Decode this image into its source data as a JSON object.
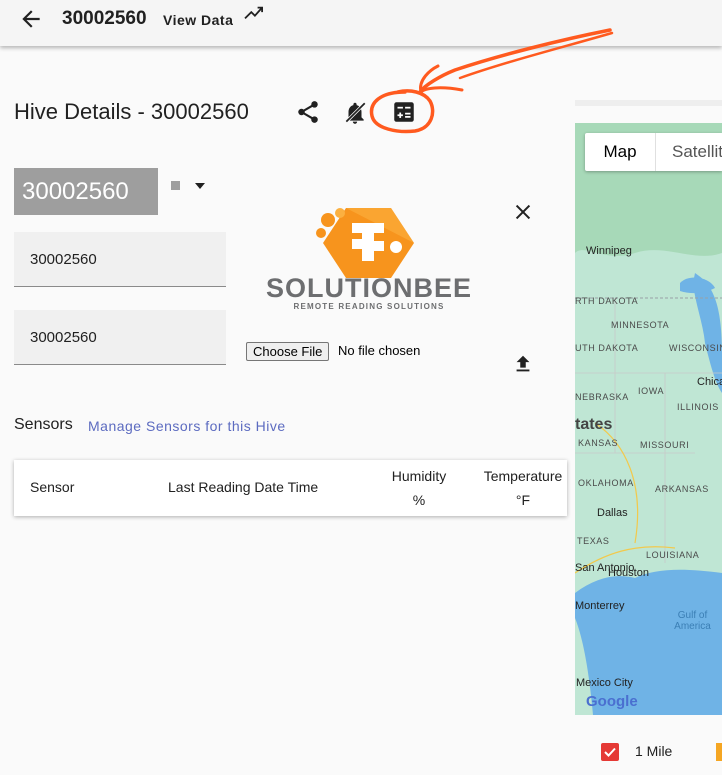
{
  "header": {
    "hive_id": "30002560",
    "subtitle": "View Data",
    "back_icon": "arrow-left-icon",
    "trend_icon": "trending-up-icon"
  },
  "details": {
    "title": "Hive Details - 30002560",
    "toolbar_icons": [
      "share-icon",
      "bell-off-icon",
      "calculator-icon"
    ],
    "annotation_color": "#ff5a1f"
  },
  "form": {
    "id_display": "30002560",
    "field1_value": "30002560",
    "field2_value": "30002560"
  },
  "logo": {
    "name": "SOLUTIONBEE",
    "tagline": "REMOTE READING SOLUTIONS"
  },
  "file": {
    "choose_label": "Choose File",
    "status": "No file chosen"
  },
  "sensors": {
    "label": "Sensors",
    "manage_link": "Manage Sensors for this Hive",
    "columns": [
      {
        "line1": "Sensor",
        "line2": ""
      },
      {
        "line1": "Last Reading Date Time",
        "line2": ""
      },
      {
        "line1": "Humidity",
        "line2": "%"
      },
      {
        "line1": "Temperature",
        "line2": "°F"
      }
    ]
  },
  "map": {
    "type_map": "Map",
    "type_satellite": "Satellite",
    "states": [
      "MINNESOTA",
      "WISCONSIN",
      "IOWA",
      "ILLINOIS",
      "MISSOURI",
      "KANSAS",
      "OKLAHOMA",
      "ARKANSAS",
      "TEXAS",
      "LOUISIANA",
      "NEBRASKA",
      "UTH DAKOTA",
      "RTH DAKOTA"
    ],
    "cities": [
      "Winnipeg",
      "Chicago",
      "Dallas",
      "Houston",
      "San Antonio",
      "Monterrey",
      "Mexico City"
    ],
    "big_label": "tates",
    "gulf": "Gulf of America",
    "attribution": "Google",
    "colors": {
      "land": "#bfe6d4",
      "water": "#6fb3e6",
      "forest": "#a7d9b8"
    }
  },
  "footer": {
    "checkbox_label": "1 Mile",
    "checkbox_checked": true,
    "checkbox_color": "#e53935"
  }
}
